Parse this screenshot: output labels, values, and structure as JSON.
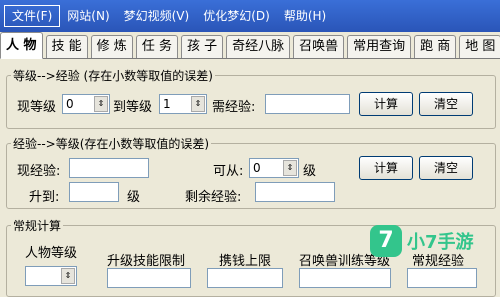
{
  "menu": {
    "items": [
      "文件(F)",
      "网站(N)",
      "梦幻视频(V)",
      "优化梦幻(D)",
      "帮助(H)"
    ]
  },
  "tabs": [
    "人 物",
    "技 能",
    "修 炼",
    "任 务",
    "孩 子",
    "奇经八脉",
    "召唤兽",
    "常用查询",
    "跑 商",
    "地 图"
  ],
  "level_to_exp": {
    "title": "等级-->经验 (存在小数等取值的误差)",
    "current_label": "现等级",
    "current_value": "0",
    "target_label": "到等级",
    "target_value": "1",
    "need_label": "需经验:",
    "need_value": "",
    "calc_label": "计算",
    "clear_label": "清空"
  },
  "exp_to_level": {
    "title": "经验-->等级(存在小数等取值的误差)",
    "current_exp_label": "现经验:",
    "current_exp_value": "",
    "can_label": "可从:",
    "can_value": "0",
    "level_unit": "级",
    "upgrade_label": "升到:",
    "upgrade_value": "",
    "upgrade_unit": "级",
    "remain_label": "剩余经验:",
    "remain_value": "",
    "calc_label": "计算",
    "clear_label": "清空"
  },
  "normal_calc": {
    "title": "常规计算",
    "headers": [
      "人物等级",
      "升级技能限制",
      "携钱上限",
      "召唤兽训练等级",
      "常规经验"
    ]
  },
  "watermark": {
    "logo": "7",
    "text": "小7手游"
  }
}
